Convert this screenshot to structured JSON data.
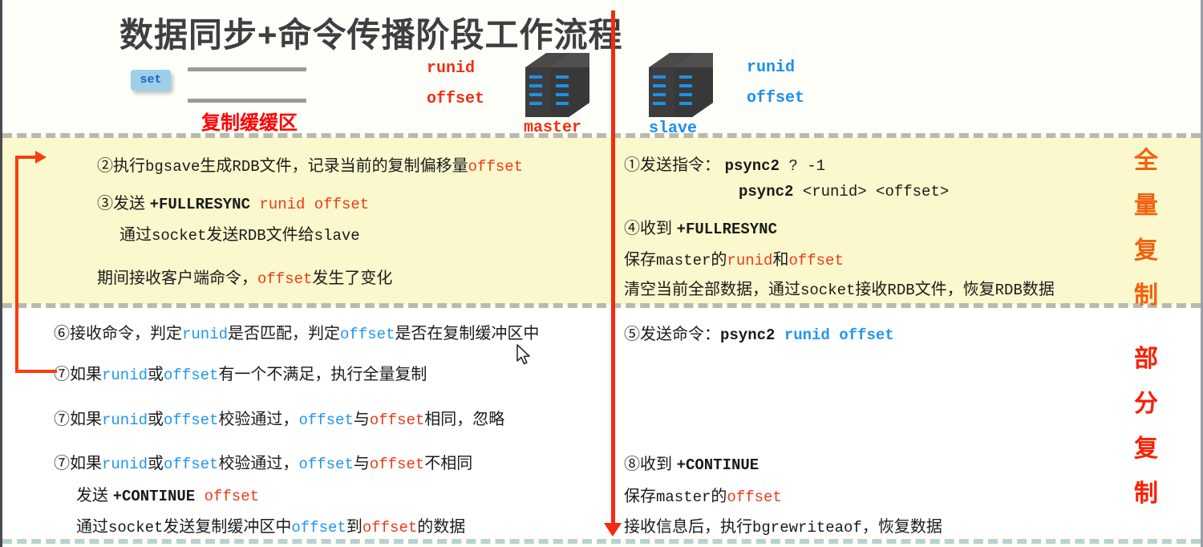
{
  "header": {
    "title": "数据同步+命令传播阶段工作流程",
    "set_chip": "set",
    "buffer_label": "复制缓缓区",
    "master": {
      "runid": "runid",
      "offset": "offset",
      "name": "master",
      "icon": "server-rack-icon"
    },
    "slave": {
      "runid": "runid",
      "offset": "offset",
      "name": "slave",
      "icon": "server-rack-icon"
    }
  },
  "sections": {
    "full_sync": {
      "side_label": "全量复制",
      "side_label_chars": [
        "全",
        "量",
        "复",
        "制"
      ],
      "background_color": "#fbf8cd",
      "accent_color": "#f4600f"
    },
    "partial_sync": {
      "side_label": "部分复制",
      "side_label_chars": [
        "部",
        "分",
        "复",
        "制"
      ],
      "background_color": "#ffffff",
      "accent_color": "#fa1f05"
    }
  },
  "master_side": {
    "full": {
      "line1_a": "②执行",
      "line1_b": "bgsave",
      "line1_c": "生成",
      "line1_d": "RDB",
      "line1_e": "文件，记录当前的复制偏移量",
      "line1_f": "offset",
      "line2_a": "③发送 ",
      "line2_b": "+FULLRESYNC",
      "line2_c": " runid offset",
      "line3_a": "通过",
      "line3_b": "socket",
      "line3_c": "发送",
      "line3_d": "RDB",
      "line3_e": "文件给",
      "line3_f": "slave",
      "line4_a": "期间接收客户端命令，",
      "line4_b": "offset",
      "line4_c": "发生了变化"
    },
    "partial": {
      "line6_a": "⑥接收命令，判定",
      "line6_b": "runid",
      "line6_c": "是否匹配，判定",
      "line6_d": "offset",
      "line6_e": "是否在复制缓冲区中",
      "line7a_a": "⑦如果",
      "line7a_b": "runid",
      "line7a_c": "或",
      "line7a_d": "offset",
      "line7a_e": "有一个不满足，执行全量复制",
      "line7b_a": "⑦如果",
      "line7b_b": "runid",
      "line7b_c": "或",
      "line7b_d": "offset",
      "line7b_e": "校验通过，",
      "line7b_f": "offset",
      "line7b_g": "与",
      "line7b_h": "offset",
      "line7b_i": "相同，忽略",
      "line7c_a": "⑦如果",
      "line7c_b": "runid",
      "line7c_c": "或",
      "line7c_d": "offset",
      "line7c_e": "校验通过，",
      "line7c_f": "offset",
      "line7c_g": "与",
      "line7c_h": "offset",
      "line7c_i": "不相同",
      "line7d_a": "发送 ",
      "line7d_b": "+CONTINUE",
      "line7d_c": " offset",
      "line7e_a": "通过",
      "line7e_b": "socket",
      "line7e_c": "发送复制缓冲区中",
      "line7e_d": "offset",
      "line7e_e": "到",
      "line7e_f": "offset",
      "line7e_g": "的数据"
    }
  },
  "slave_side": {
    "full": {
      "line1_a": "①发送指令：  ",
      "line1_b": "psync2",
      "line1_c": "  ? -1",
      "line2_a": "psync2",
      "line2_b": "  <runid> <offset>",
      "line4_a": "④收到 ",
      "line4_b": "+FULLRESYNC",
      "line5_a": "保存",
      "line5_b": "master",
      "line5_c": "的",
      "line5_d": "runid",
      "line5_e": "和",
      "line5_f": "offset",
      "line6_a": "清空当前全部数据，通过",
      "line6_b": "socket",
      "line6_c": "接收",
      "line6_d": "RDB",
      "line6_e": "文件，恢复",
      "line6_f": "RDB",
      "line6_g": "数据"
    },
    "partial": {
      "line5_a": "⑤发送命令：",
      "line5_b": "psync2",
      "line5_c": "  runid offset",
      "line8_a": "⑧收到 ",
      "line8_b": "+CONTINUE",
      "line9_a": "保存",
      "line9_b": "master",
      "line9_c": "的",
      "line9_d": "offset",
      "line10_a": "接收信息后，执行",
      "line10_b": "bgrewriteaof",
      "line10_c": "，恢复数据"
    }
  },
  "colors": {
    "red_text": "#ef3b18",
    "blue_text": "#2196f3",
    "title_gray": "#3f3f42",
    "band_yellow": "#fbf8cd",
    "arrow_red": "#f42b12"
  }
}
